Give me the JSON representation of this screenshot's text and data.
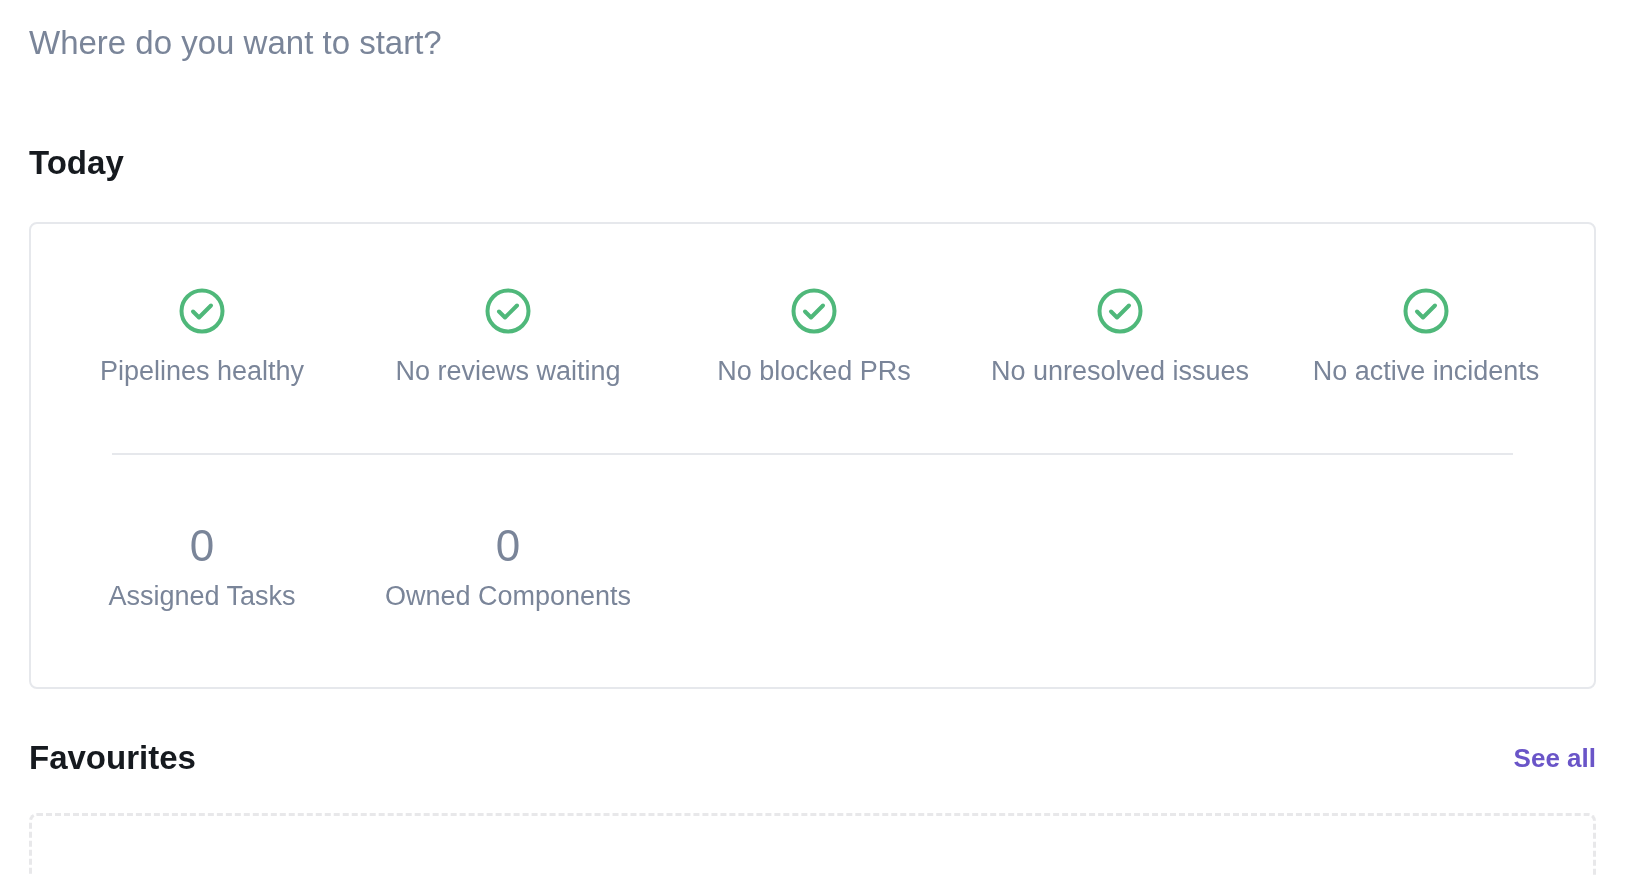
{
  "prompt": "Where do you want to start?",
  "today": {
    "title": "Today",
    "statuses": [
      {
        "label": "Pipelines healthy",
        "ok": true
      },
      {
        "label": "No reviews waiting",
        "ok": true
      },
      {
        "label": "No blocked PRs",
        "ok": true
      },
      {
        "label": "No unresolved issues",
        "ok": true
      },
      {
        "label": "No active incidents",
        "ok": true
      }
    ],
    "counts": [
      {
        "value": "0",
        "label": "Assigned Tasks"
      },
      {
        "value": "0",
        "label": "Owned Components"
      }
    ]
  },
  "favourites": {
    "title": "Favourites",
    "link": "See all"
  }
}
